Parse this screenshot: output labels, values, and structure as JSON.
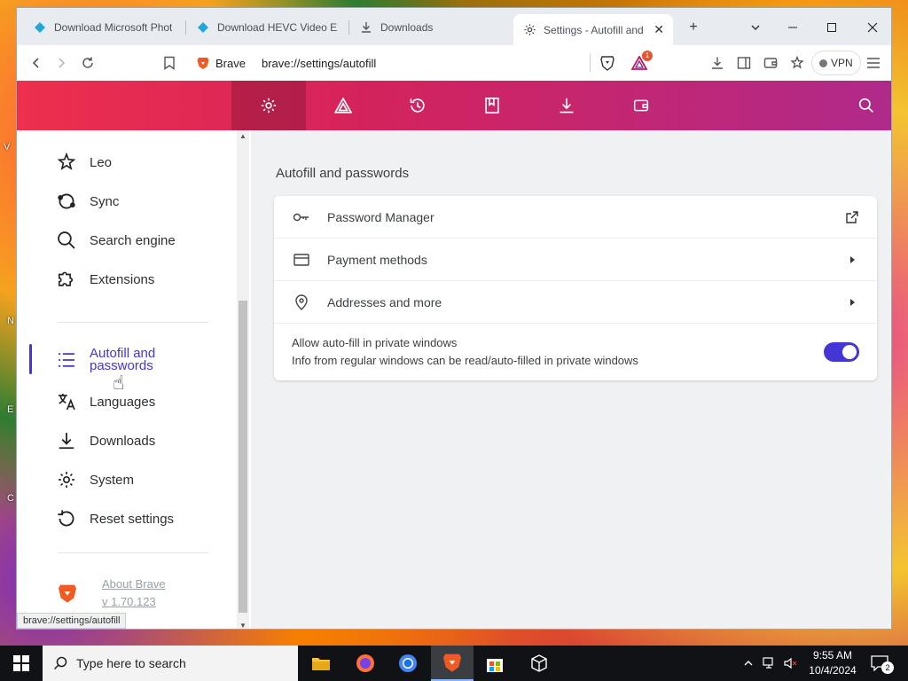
{
  "desktop": {
    "labels": [
      "V",
      "N",
      "E",
      "C"
    ]
  },
  "tabs": [
    {
      "title": "Download Microsoft Phot",
      "icon": "kodi-icon"
    },
    {
      "title": "Download HEVC Video Ex",
      "icon": "kodi-icon"
    },
    {
      "title": "Downloads",
      "icon": "download-icon"
    },
    {
      "title": "Settings - Autofill and",
      "icon": "gear-icon",
      "close": "✕"
    }
  ],
  "toolbar": {
    "brand_label": "Brave",
    "url": "brave://settings/autofill",
    "vpn_label": "VPN",
    "rewards_badge": "1"
  },
  "sidebar": {
    "items": [
      {
        "label": "Leo",
        "icon": "leo-star-icon"
      },
      {
        "label": "Sync",
        "icon": "sync-icon"
      },
      {
        "label": "Search engine",
        "icon": "search-icon"
      },
      {
        "label": "Extensions",
        "icon": "puzzle-icon"
      },
      {
        "label": "Autofill and passwords",
        "icon": "list-icon",
        "active": true
      },
      {
        "label": "Languages",
        "icon": "translate-icon"
      },
      {
        "label": "Downloads",
        "icon": "download-icon"
      },
      {
        "label": "System",
        "icon": "gear-icon"
      },
      {
        "label": "Reset settings",
        "icon": "reset-icon"
      }
    ],
    "about_label": "About Brave",
    "version": "v 1.70.123"
  },
  "main": {
    "section_title": "Autofill and passwords",
    "rows": [
      {
        "label": "Password Manager",
        "icon": "key-icon",
        "end": "external-link-icon"
      },
      {
        "label": "Payment methods",
        "icon": "card-icon",
        "end": "arrow-right-icon"
      },
      {
        "label": "Addresses and more",
        "icon": "location-pin-icon",
        "end": "arrow-right-icon"
      }
    ],
    "toggle": {
      "title": "Allow auto-fill in private windows",
      "subtitle": "Info from regular windows can be read/auto-filled in private windows",
      "checked": true
    }
  },
  "statusbar": {
    "text": "brave://settings/autofill"
  },
  "taskbar": {
    "search_placeholder": "Type here to search",
    "time": "9:55 AM",
    "date": "10/4/2024",
    "notification_count": "2"
  },
  "colors": {
    "accent": "#4436d6",
    "brand_start": "#ee2f4d",
    "brand_end": "#b02a8a"
  }
}
